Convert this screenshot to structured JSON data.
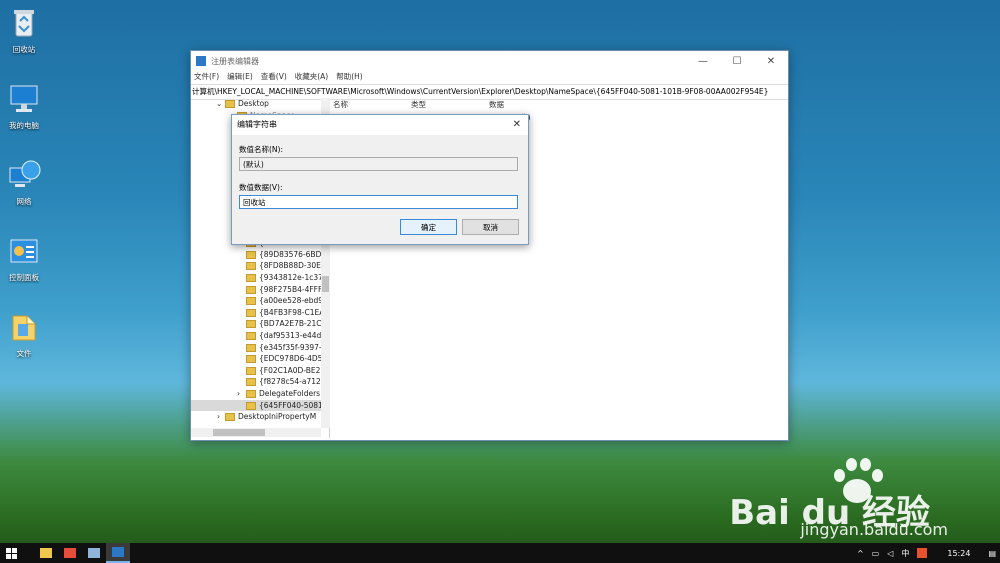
{
  "desktop": {
    "icons": [
      {
        "label": "回收站"
      },
      {
        "label": "我的电脑"
      },
      {
        "label": "网络"
      },
      {
        "label": "控制面板"
      },
      {
        "label": "文件"
      }
    ]
  },
  "watermark": {
    "logo": "Bai du 经验",
    "url": "jingyan.baidu.com"
  },
  "regedit": {
    "title": "注册表编辑器",
    "menu": [
      "文件(F)",
      "编辑(E)",
      "查看(V)",
      "收藏夹(A)",
      "帮助(H)"
    ],
    "address": "计算机\\HKEY_LOCAL_MACHINE\\SOFTWARE\\Microsoft\\Windows\\CurrentVersion\\Explorer\\Desktop\\NameSpace\\{645FF040-5081-101B-9F08-00AA002F954E}",
    "tree": {
      "top": "Desktop",
      "partial": "NameSpace",
      "items": [
        "{64693913-1c21",
        "{89D83576-6BD",
        "{8FD8B88D-30E",
        "{9343812e-1c37",
        "{98F275B4-4FFF",
        "{a00ee528-ebd9",
        "{B4FB3F98-C1EA",
        "{BD7A2E7B-21CB",
        "{daf95313-e44d",
        "{e345f35f-9397-",
        "{EDC978D6-4D5",
        "{F02C1A0D-BE2",
        "{f8278c54-a712-",
        "DelegateFolders",
        "{645FF040-5081"
      ],
      "bottom": "DesktopIniPropertyM"
    },
    "columns": [
      "名称",
      "类型",
      "数据"
    ],
    "partial_data": "值)"
  },
  "dialog": {
    "title": "编辑字符串",
    "name_label": "数值名称(N):",
    "name_value": "(默认)",
    "data_label": "数值数据(V):",
    "data_value": "回收站",
    "ok": "确定",
    "cancel": "取消"
  },
  "taskbar": {
    "time": "15:24",
    "ime": "中"
  }
}
